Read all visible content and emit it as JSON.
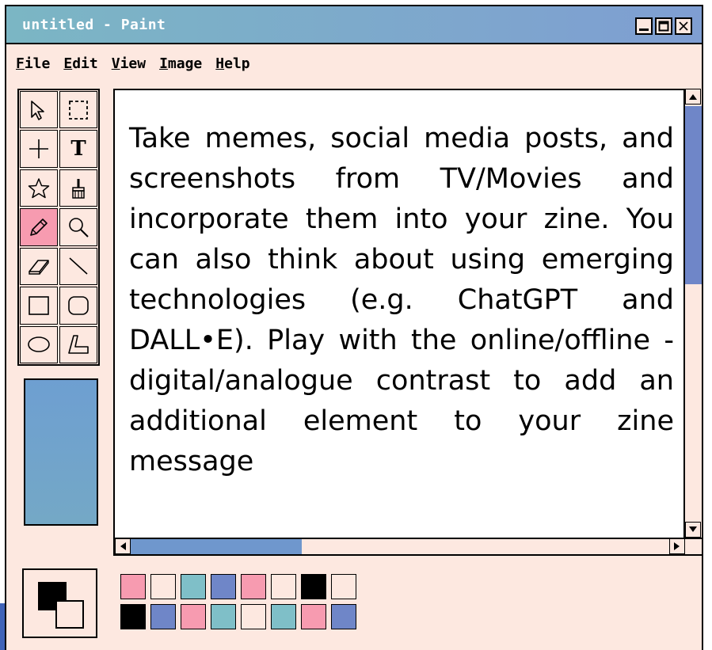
{
  "window": {
    "title": "untitled - Paint"
  },
  "menu": [
    {
      "label": "File",
      "mnemonic": "F",
      "rest": "ile"
    },
    {
      "label": "Edit",
      "mnemonic": "E",
      "rest": "dit"
    },
    {
      "label": "View",
      "mnemonic": "V",
      "rest": "iew"
    },
    {
      "label": "Image",
      "mnemonic": "I",
      "rest": "mage"
    },
    {
      "label": "Help",
      "mnemonic": "H",
      "rest": "elp"
    }
  ],
  "tools": [
    {
      "icon": "pointer-arrow-icon",
      "active": false
    },
    {
      "icon": "rect-select-icon",
      "active": false
    },
    {
      "icon": "crosshair-icon",
      "active": false
    },
    {
      "icon": "text-icon",
      "active": false,
      "glyph": "T"
    },
    {
      "icon": "star-icon",
      "active": false
    },
    {
      "icon": "brush-icon",
      "active": false
    },
    {
      "icon": "pencil-icon",
      "active": true
    },
    {
      "icon": "magnifier-icon",
      "active": false
    },
    {
      "icon": "eraser-icon",
      "active": false
    },
    {
      "icon": "line-icon",
      "active": false
    },
    {
      "icon": "rectangle-icon",
      "active": false
    },
    {
      "icon": "rounded-rectangle-icon",
      "active": false
    },
    {
      "icon": "ellipse-icon",
      "active": false
    },
    {
      "icon": "polygon-icon",
      "active": false
    }
  ],
  "canvas": {
    "text": "Take memes, social media posts, and screenshots from TV/Movies and incorporate them into your zine. You can also think about using emerging technologies (e.g. ChatGPT and DALL•E). Play with the online/offline - digital/analogue contrast to add an additional element to your zine message"
  },
  "colors": {
    "foreground": "#000000",
    "background": "#fde8e0",
    "palette": [
      "#f79bb0",
      "#fde8e0",
      "#7fbfc8",
      "#6f86c8",
      "#f79bb0",
      "#fde8e0",
      "#000000",
      "#fde8e0",
      "#000000",
      "#6f86c8",
      "#f79bb0",
      "#7fbfc8",
      "#fde8e0",
      "#7fbfc8",
      "#f79bb0",
      "#6f86c8"
    ]
  }
}
